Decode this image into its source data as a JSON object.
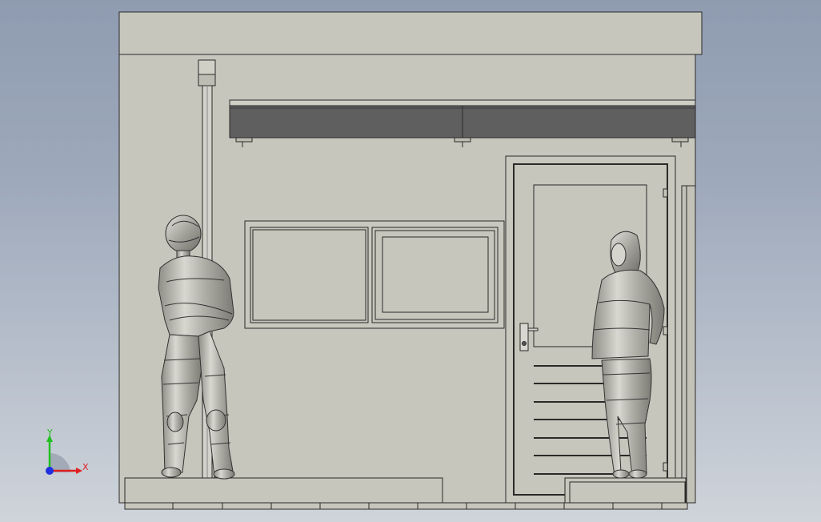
{
  "viewport": {
    "background_top": "#8f9bb0",
    "background_bottom": "#cfd4da",
    "model_fill": "#c6c6bc",
    "model_edge": "#2a2a2a",
    "dark_panel": "#5f5f5f"
  },
  "triad": {
    "x_label": "X",
    "y_label": "Y",
    "x_color": "#e02020",
    "y_color": "#20c020",
    "z_color": "#2030e0"
  },
  "model": {
    "figures": [
      "man-figure",
      "woman-figure"
    ]
  }
}
